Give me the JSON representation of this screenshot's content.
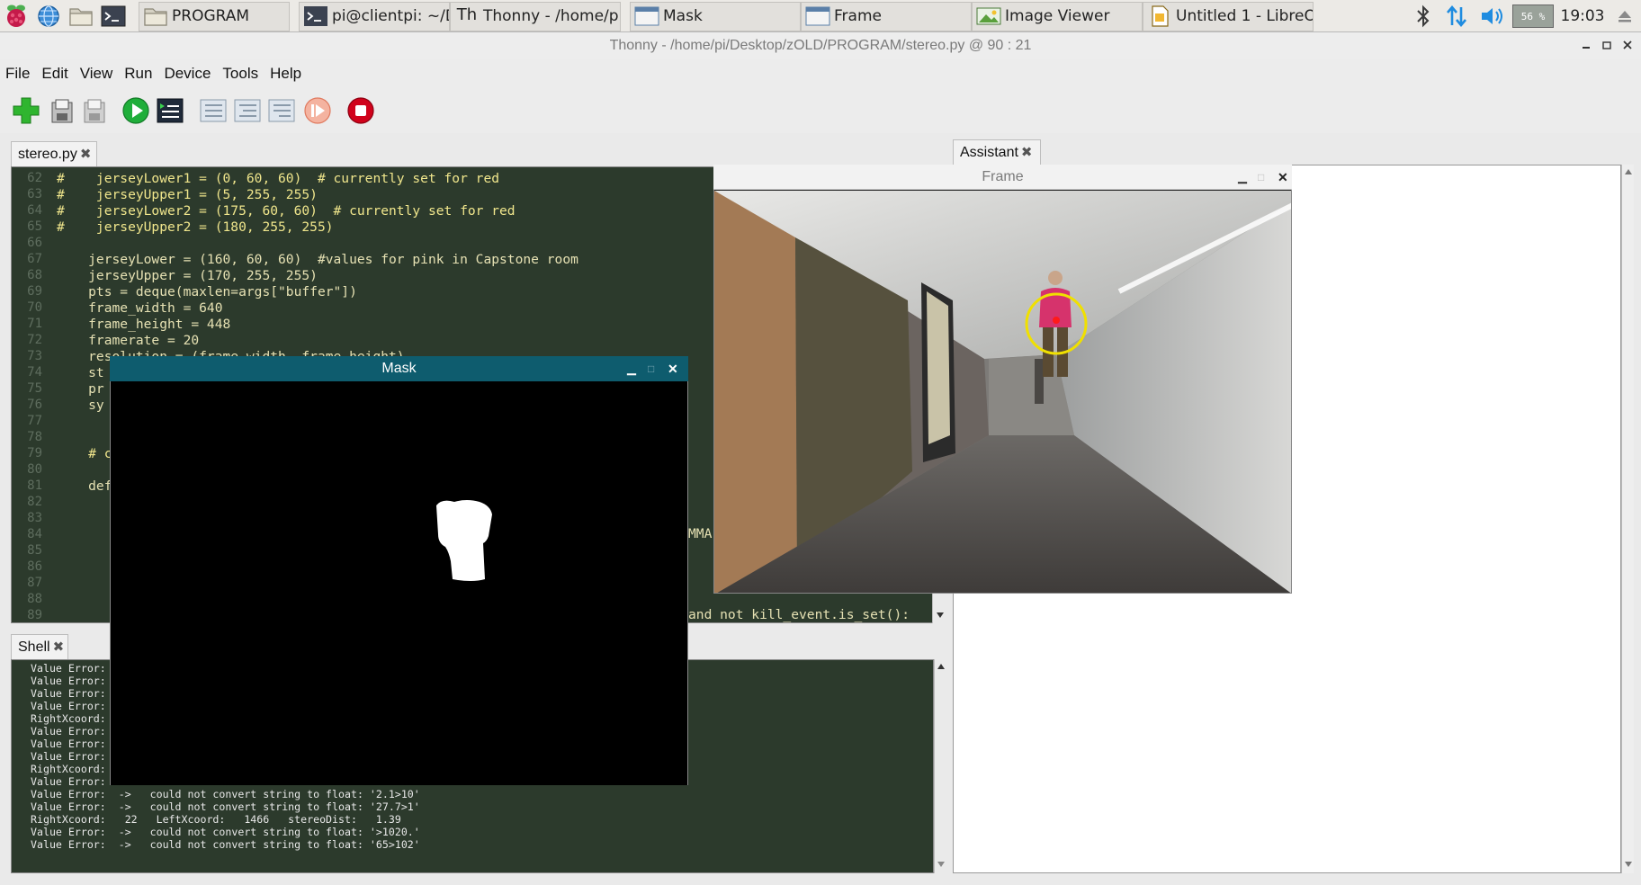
{
  "taskbar": {
    "tasks": [
      {
        "label": "PROGRAM"
      },
      {
        "label": "pi@clientpi: ~/Deskt..."
      },
      {
        "label": "Thonny  -  /home/pi/..."
      },
      {
        "label": "Mask"
      },
      {
        "label": "Frame"
      },
      {
        "label": "Image Viewer"
      },
      {
        "label": "Untitled 1 - LibreOffic..."
      }
    ],
    "cpu_label": "56 %",
    "clock": "19:03"
  },
  "window": {
    "title": "Thonny  -  /home/pi/Desktop/zOLD/PROGRAM/stereo.py  @  90 : 21"
  },
  "menu": [
    "File",
    "Edit",
    "View",
    "Run",
    "Device",
    "Tools",
    "Help"
  ],
  "editor": {
    "tab_label": "stereo.py",
    "line_numbers": [
      "62",
      "63",
      "64",
      "65",
      "66",
      "67",
      "68",
      "69",
      "70",
      "71",
      "72",
      "73",
      "74",
      "75",
      "76",
      "77",
      "78",
      "79",
      "80",
      "81",
      "82",
      "83",
      "84",
      "85",
      "86",
      "87",
      "88",
      "89"
    ],
    "lines": [
      "#    jerseyLower1 = (0, 60, 60)  # currently set for red",
      "#    jerseyUpper1 = (5, 255, 255)",
      "#    jerseyLower2 = (175, 60, 60)  # currently set for red",
      "#    jerseyUpper2 = (180, 255, 255)",
      "",
      "    jerseyLower = (160, 60, 60)  #values for pink in Capstone room",
      "    jerseyUpper = (170, 255, 255)",
      "    pts = deque(maxlen=args[\"buffer\"])",
      "    frame_width = 640",
      "    frame_height = 448",
      "    framerate = 20",
      "    resolution = (frame_width, frame_height)",
      "    st",
      "    pr",
      "    sy",
      "",
      "",
      "    # c",
      "",
      "    def",
      "",
      "",
      "",
      "",
      "",
      "",
      "",
      ""
    ],
    "overflow_fragments": [
      "MMA",
      "and not kill_event.is_set():"
    ]
  },
  "shell": {
    "tab_label": "Shell",
    "lines": [
      "Value Error:",
      "Value Error:",
      "Value Error:",
      "Value Error:",
      "RightXcoord:",
      "Value Error:",
      "Value Error:",
      "Value Error:",
      "RightXcoord:",
      "Value Error:",
      "Value Error:  ->   could not convert string to float: '2.1>10'",
      "Value Error:  ->   could not convert string to float: '27.7>1'",
      "RightXcoord:   22   LeftXcoord:   1466   stereoDist:   1.39",
      "Value Error:  ->   could not convert string to float: '>1020.'",
      "Value Error:  ->   could not convert string to float: '65>102'"
    ]
  },
  "assistant": {
    "tab_label": "Assistant"
  },
  "mask_window": {
    "title": "Mask"
  },
  "frame_window": {
    "title": "Frame"
  },
  "colors": {
    "editor_bg": "#2c3a2c",
    "mask_titlebar": "#0e5c6e",
    "tracking_circle": "#f0e000",
    "jersey": "#d6336c",
    "stop_button": "#d0021b",
    "run_button": "#1fae3a"
  }
}
